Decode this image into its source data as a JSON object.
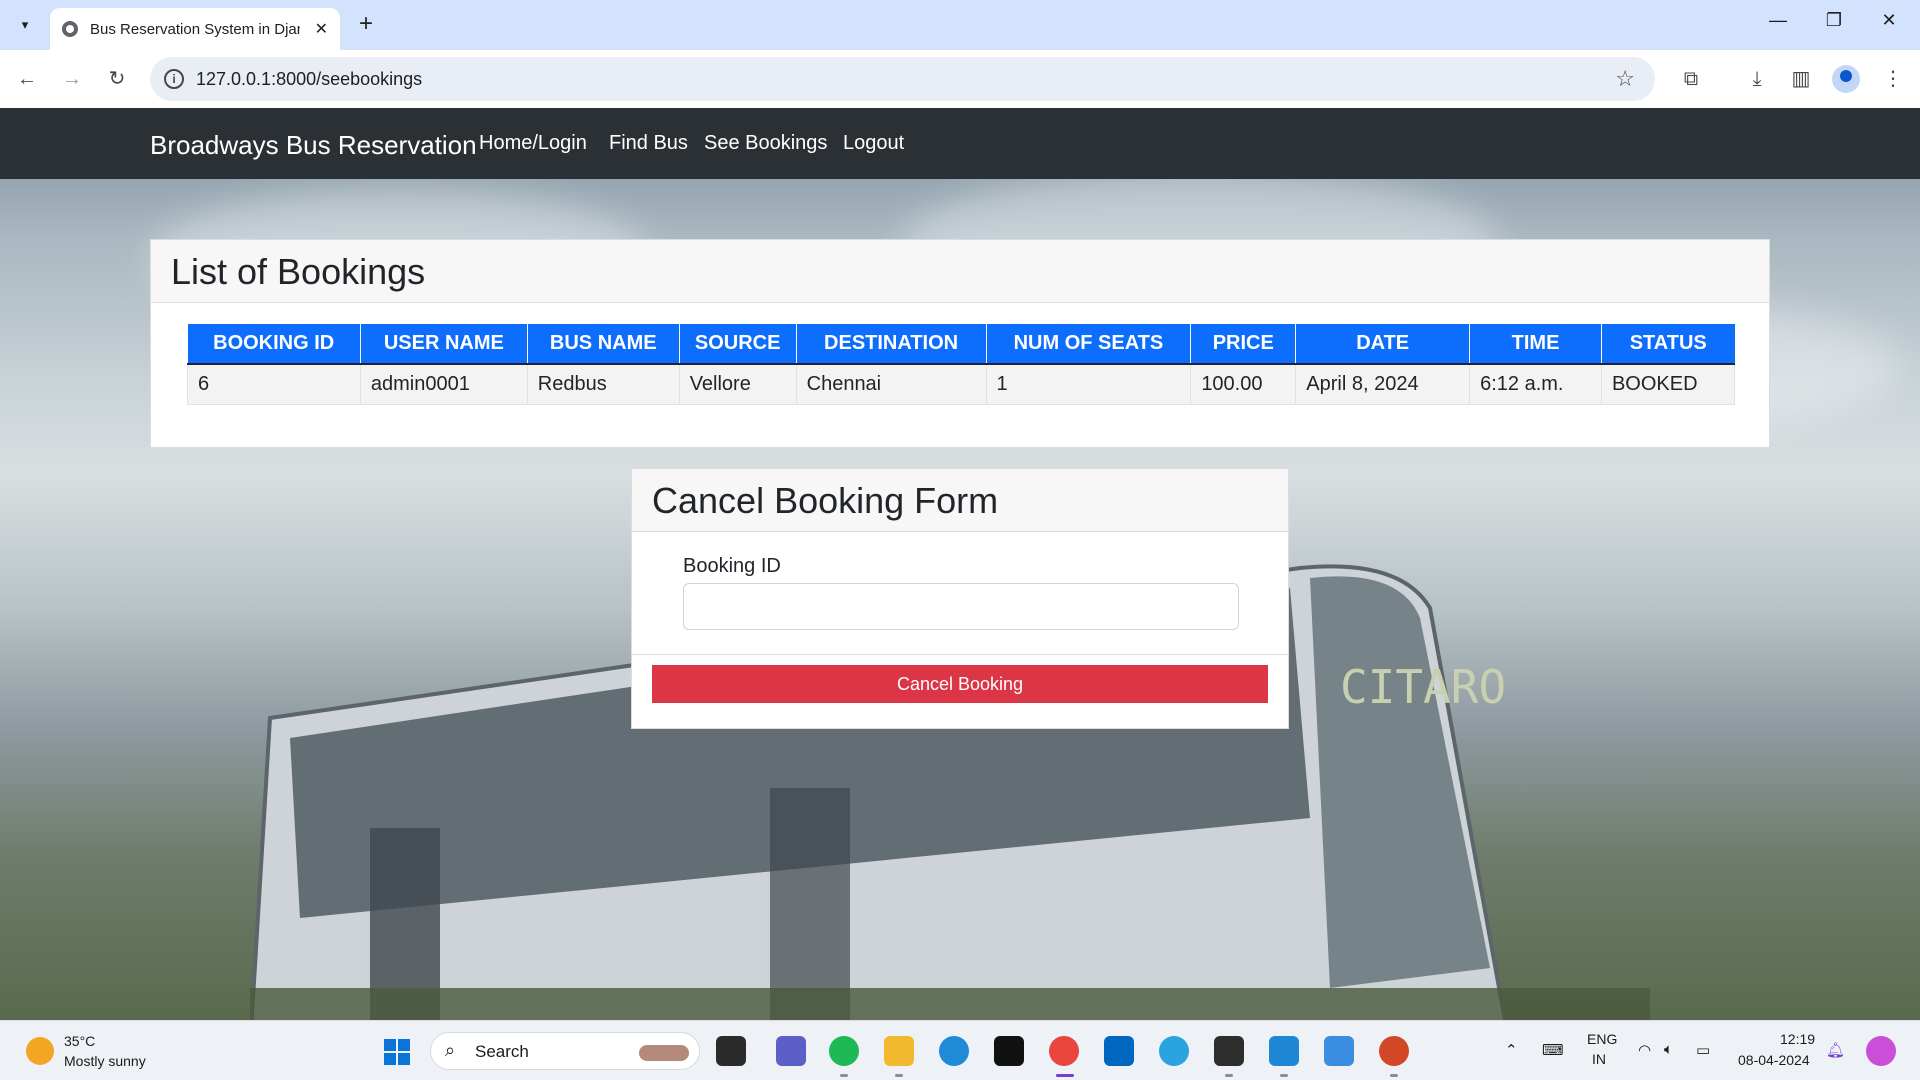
{
  "browser": {
    "tab_title": "Bus Reservation System in Djan",
    "url": "127.0.0.1:8000/seebookings"
  },
  "navbar": {
    "brand": "Broadways Bus Reservation",
    "links": [
      "Home/Login",
      "Find Bus",
      "See Bookings",
      "Logout"
    ]
  },
  "bookings_card": {
    "title": "List of Bookings",
    "columns": [
      "BOOKING ID",
      "USER NAME",
      "BUS NAME",
      "SOURCE",
      "DESTINATION",
      "NUM OF SEATS",
      "PRICE",
      "DATE",
      "TIME",
      "STATUS"
    ],
    "rows": [
      [
        "6",
        "admin0001",
        "Redbus",
        "Vellore",
        "Chennai",
        "1",
        "100.00",
        "April 8, 2024",
        "6:12 a.m.",
        "BOOKED"
      ]
    ]
  },
  "cancel_form": {
    "title": "Cancel Booking Form",
    "field_label": "Booking ID",
    "field_value": "",
    "button_label": "Cancel Booking"
  },
  "background": {
    "bus_text": "CITARO"
  },
  "taskbar": {
    "weather_temp": "35°C",
    "weather_desc": "Mostly sunny",
    "search_label": "Search",
    "lang_line1": "ENG",
    "lang_line2": "IN",
    "time": "12:19",
    "date": "08-04-2024"
  },
  "colors": {
    "navbar_bg": "#2b3035",
    "table_header": "#0d6efd",
    "cancel_button": "#dc3545"
  }
}
